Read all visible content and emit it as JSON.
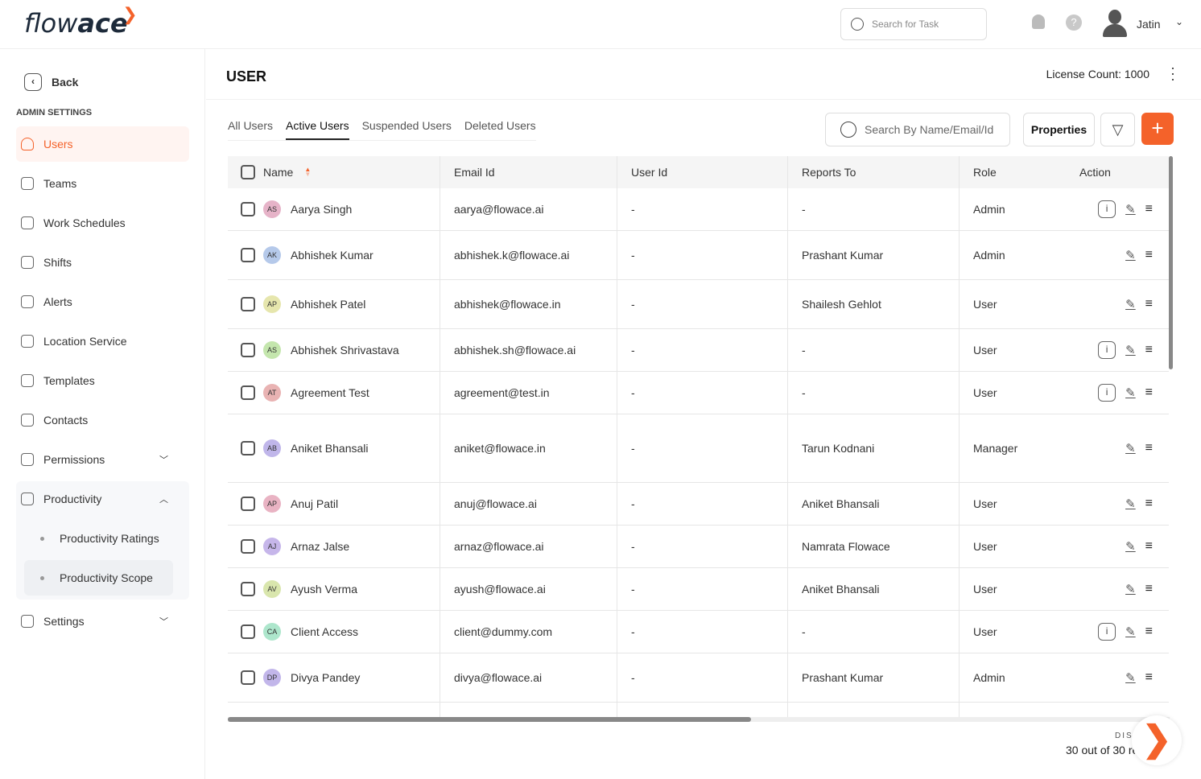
{
  "header": {
    "logo": "flowace",
    "search_placeholder": "Search for Task",
    "user_name": "Jatin"
  },
  "sidebar": {
    "back": "Back",
    "section": "ADMIN SETTINGS",
    "items": [
      {
        "label": "Users",
        "icon": "user-icon",
        "active": true
      },
      {
        "label": "Teams",
        "icon": "team-icon"
      },
      {
        "label": "Work Schedules",
        "icon": "calendar-icon"
      },
      {
        "label": "Shifts",
        "icon": "shift-icon"
      },
      {
        "label": "Alerts",
        "icon": "alert-icon"
      },
      {
        "label": "Location Service",
        "icon": "location-icon"
      },
      {
        "label": "Templates",
        "icon": "folder-icon"
      },
      {
        "label": "Contacts",
        "icon": "contact-icon"
      },
      {
        "label": "Permissions",
        "icon": "lock-icon",
        "expandable": true
      },
      {
        "label": "Productivity",
        "icon": "productivity-icon",
        "expanded": true
      },
      {
        "label": "Settings",
        "icon": "settings-icon",
        "expandable": true
      }
    ],
    "sub_items": [
      "Productivity Ratings",
      "Productivity Scope"
    ]
  },
  "page": {
    "title": "USER",
    "license": "License Count: 1000",
    "tabs": [
      "All Users",
      "Active Users",
      "Suspended Users",
      "Deleted Users"
    ],
    "active_tab": "Active Users",
    "search_placeholder": "Search By Name/Email/Id",
    "properties": "Properties",
    "add": "+"
  },
  "table": {
    "columns": [
      "Name",
      "Email Id",
      "User Id",
      "Reports To",
      "Role",
      "Action"
    ],
    "rows": [
      {
        "initials": "AS",
        "color": "#e6b3c8",
        "name": "Aarya Singh",
        "email": "aarya@flowace.ai",
        "id": "-",
        "reports": "-",
        "role": "Admin",
        "info": true
      },
      {
        "initials": "AK",
        "color": "#b5c9ea",
        "name": "Abhishek Kumar",
        "email": "abhishek.k@flowace.ai",
        "id": "-",
        "reports": "Prashant Kumar",
        "role": "Admin",
        "info": false
      },
      {
        "initials": "AP",
        "color": "#e6e6ad",
        "name": "Abhishek Patel",
        "email": "abhishek@flowace.in",
        "id": "-",
        "reports": "Shailesh Gehlot",
        "role": "User",
        "info": false
      },
      {
        "initials": "AS",
        "color": "#c4e6ad",
        "name": "Abhishek Shrivastava",
        "email": "abhishek.sh@flowace.ai",
        "id": "-",
        "reports": "-",
        "role": "User",
        "info": true
      },
      {
        "initials": "AT",
        "color": "#e9b3b3",
        "name": "Agreement Test",
        "email": "agreement@test.in",
        "id": "-",
        "reports": "-",
        "role": "User",
        "info": true
      },
      {
        "initials": "AB",
        "color": "#c0b6ea",
        "name": "Aniket Bhansali",
        "email": "aniket@flowace.in",
        "id": "-",
        "reports": "Tarun Kodnani",
        "role": "Manager",
        "info": false
      },
      {
        "initials": "AP",
        "color": "#e9b3c3",
        "name": "Anuj Patil",
        "email": "anuj@flowace.ai",
        "id": "-",
        "reports": "Aniket Bhansali",
        "role": "User",
        "info": false
      },
      {
        "initials": "AJ",
        "color": "#c6b6ea",
        "name": "Arnaz Jalse",
        "email": "arnaz@flowace.ai",
        "id": "-",
        "reports": "Namrata Flowace",
        "role": "User",
        "info": false
      },
      {
        "initials": "AV",
        "color": "#d9e6ad",
        "name": "Ayush Verma",
        "email": "ayush@flowace.ai",
        "id": "-",
        "reports": "Aniket Bhansali",
        "role": "User",
        "info": false
      },
      {
        "initials": "CA",
        "color": "#ade6cc",
        "name": "Client Access",
        "email": "client@dummy.com",
        "id": "-",
        "reports": "-",
        "role": "User",
        "info": true
      },
      {
        "initials": "DP",
        "color": "#c2b6ea",
        "name": "Divya Pandey",
        "email": "divya@flowace.ai",
        "id": "-",
        "reports": "Prashant Kumar",
        "role": "Admin",
        "info": false
      }
    ]
  },
  "footer": {
    "display_label": "DISPLAYING",
    "count": "30 out of 30 records"
  },
  "colors": {
    "accent": "#f4622a"
  }
}
